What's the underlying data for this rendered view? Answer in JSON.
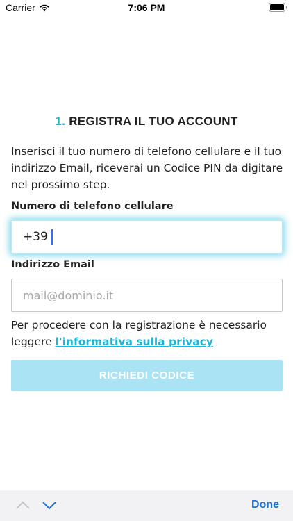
{
  "status_bar": {
    "carrier": "Carrier",
    "time": "7:06 PM",
    "wifi_icon": "wifi-icon",
    "battery_icon": "battery-icon"
  },
  "form": {
    "title_number": "1.",
    "title_text": "REGISTRA IL TUO ACCOUNT",
    "intro": "Inserisci il tuo numero di telefono cellulare e il tuo indirizzo Email, riceverai un Codice PIN da digitare nel prossimo step.",
    "phone_label": "Numero di telefono cellulare",
    "phone_value": "+39",
    "email_label": "Indirizzo Email",
    "email_placeholder": "mail@dominio.it",
    "notice_text": "Per procedere con la registrazione è necessario leggere",
    "privacy_link": "l'informativa sulla privacy",
    "submit_label": "RICHIEDI CODICE"
  },
  "keyboard_toolbar": {
    "up_icon": "chevron-up-icon",
    "down_icon": "chevron-down-icon",
    "done_label": "Done"
  },
  "colors": {
    "accent": "#1cb6d8",
    "button_disabled": "#a9e3f4",
    "toolbar_done": "#1a73d8"
  }
}
